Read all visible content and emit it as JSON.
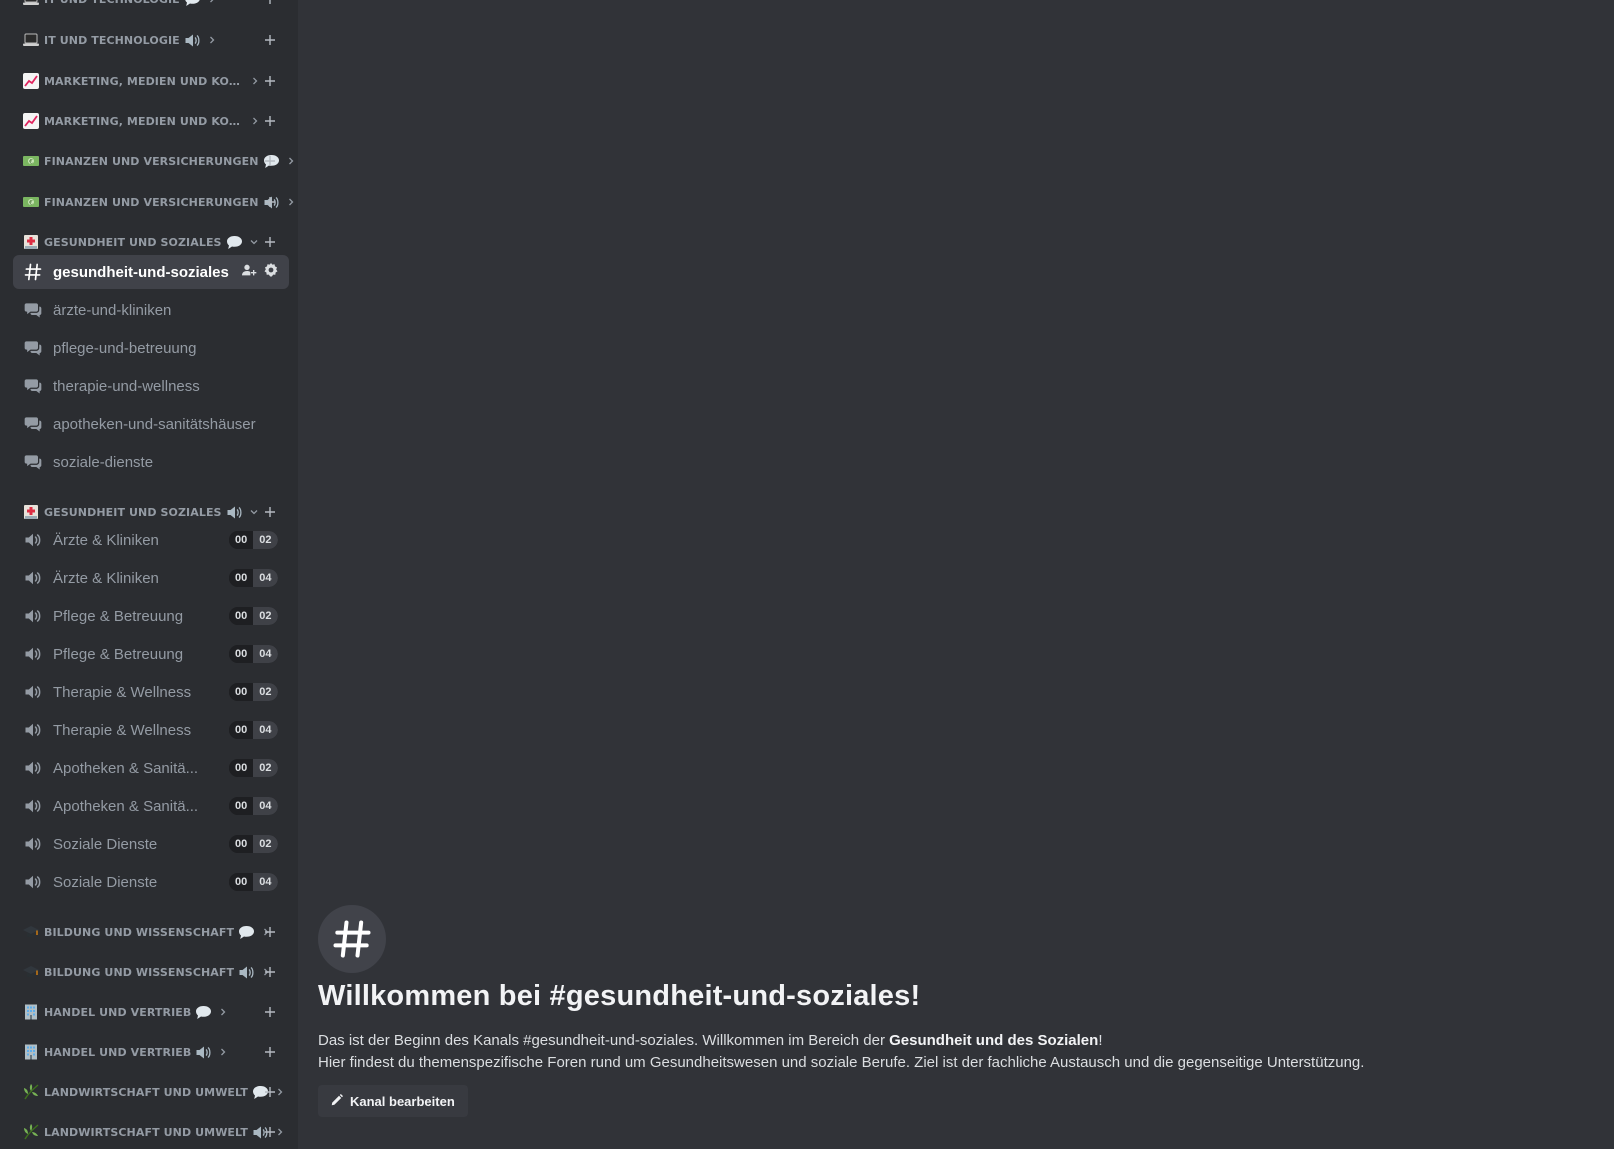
{
  "sidebar": {
    "categories": [
      {
        "emoji": "laptop-emoji",
        "label": "IT und Technologie",
        "type": "text",
        "expanded": false
      },
      {
        "emoji": "laptop-emoji",
        "label": "IT und Technologie",
        "type": "voice",
        "expanded": false
      },
      {
        "emoji": "chart-emoji",
        "label": "Marketing, Medien und Kommuni...",
        "type": "text",
        "expanded": false
      },
      {
        "emoji": "chart-emoji",
        "label": "Marketing, Medien und Kommuni...",
        "type": "voice",
        "expanded": false
      },
      {
        "emoji": "money-emoji",
        "label": "Finanzen und Versicherungen",
        "type": "text",
        "expanded": false
      },
      {
        "emoji": "money-emoji",
        "label": "Finanzen und Versicherungen",
        "type": "voice",
        "expanded": false
      },
      {
        "emoji": "hospital-emoji",
        "label": "Gesundheit und Soziales",
        "type": "text",
        "expanded": true
      },
      {
        "emoji": "hospital-emoji",
        "label": "Gesundheit und Soziales",
        "type": "voice",
        "expanded": true
      },
      {
        "emoji": "graduation-cap-emoji",
        "label": "Bildung und Wissenschaft",
        "type": "text",
        "expanded": false
      },
      {
        "emoji": "graduation-cap-emoji",
        "label": "Bildung und Wissenschaft",
        "type": "voice",
        "expanded": false
      },
      {
        "emoji": "office-emoji",
        "label": "Handel und Vertrieb",
        "type": "text",
        "expanded": false
      },
      {
        "emoji": "office-emoji",
        "label": "Handel und Vertrieb",
        "type": "voice",
        "expanded": false
      },
      {
        "emoji": "herb-emoji",
        "label": "Landwirtschaft und Umwelt",
        "type": "text",
        "expanded": false
      },
      {
        "emoji": "herb-emoji",
        "label": "Landwirtschaft und Umwelt",
        "type": "voice",
        "expanded": false
      }
    ],
    "text_channels": [
      {
        "name": "gesundheit-und-soziales",
        "type": "text",
        "active": true
      },
      {
        "name": "ärzte-und-kliniken",
        "type": "forum"
      },
      {
        "name": "pflege-und-betreuung",
        "type": "forum"
      },
      {
        "name": "therapie-und-wellness",
        "type": "forum"
      },
      {
        "name": "apotheken-und-sanitätshäuser",
        "type": "forum"
      },
      {
        "name": "soziale-dienste",
        "type": "forum"
      }
    ],
    "voice_channels": [
      {
        "name": "Ärzte & Kliniken",
        "count": "00",
        "limit": "02"
      },
      {
        "name": "Ärzte & Kliniken",
        "count": "00",
        "limit": "04"
      },
      {
        "name": "Pflege & Betreuung",
        "count": "00",
        "limit": "02"
      },
      {
        "name": "Pflege & Betreuung",
        "count": "00",
        "limit": "04"
      },
      {
        "name": "Therapie & Wellness",
        "count": "00",
        "limit": "02"
      },
      {
        "name": "Therapie & Wellness",
        "count": "00",
        "limit": "04"
      },
      {
        "name": "Apotheken & Sanitä...",
        "count": "00",
        "limit": "02"
      },
      {
        "name": "Apotheken & Sanitä...",
        "count": "00",
        "limit": "04"
      },
      {
        "name": "Soziale Dienste",
        "count": "00",
        "limit": "02"
      },
      {
        "name": "Soziale Dienste",
        "count": "00",
        "limit": "04"
      }
    ]
  },
  "welcome": {
    "title": "Willkommen bei #gesundheit-und-soziales!",
    "line1_prefix": "Das ist der Beginn des Kanals #gesundheit-und-soziales. Willkommen im Bereich der ",
    "line1_bold": "Gesundheit und des Sozialen",
    "line1_suffix": "!",
    "line2": "Hier findest du themenspezifische Foren rund um Gesundheitswesen und soziale Berufe. Ziel ist der fachliche Austausch und die gegenseitige Unterstützung.",
    "edit_button": "Kanal bearbeiten"
  },
  "colors": {
    "sidebar_bg": "#2b2d31",
    "main_bg": "#313338",
    "muted": "#949ba4",
    "active_bg": "#404249",
    "text": "#dbdee1",
    "white": "#ffffff"
  }
}
